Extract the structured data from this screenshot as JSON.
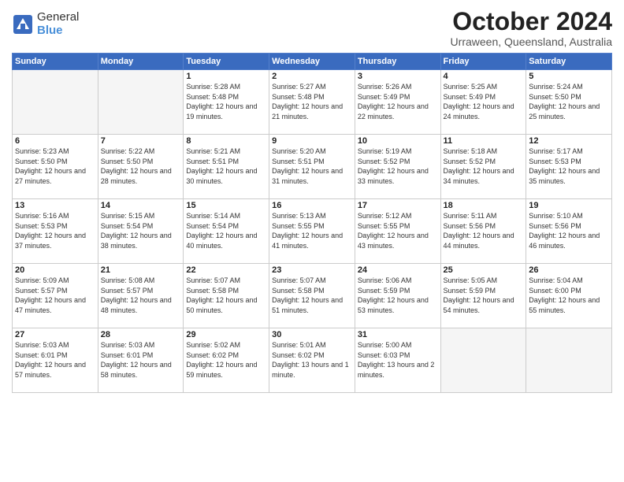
{
  "logo": {
    "general": "General",
    "blue": "Blue"
  },
  "header": {
    "month": "October 2024",
    "location": "Urraween, Queensland, Australia"
  },
  "weekdays": [
    "Sunday",
    "Monday",
    "Tuesday",
    "Wednesday",
    "Thursday",
    "Friday",
    "Saturday"
  ],
  "weeks": [
    [
      {
        "day": "",
        "empty": true
      },
      {
        "day": "",
        "empty": true
      },
      {
        "day": "1",
        "sunrise": "Sunrise: 5:28 AM",
        "sunset": "Sunset: 5:48 PM",
        "daylight": "Daylight: 12 hours and 19 minutes."
      },
      {
        "day": "2",
        "sunrise": "Sunrise: 5:27 AM",
        "sunset": "Sunset: 5:48 PM",
        "daylight": "Daylight: 12 hours and 21 minutes."
      },
      {
        "day": "3",
        "sunrise": "Sunrise: 5:26 AM",
        "sunset": "Sunset: 5:49 PM",
        "daylight": "Daylight: 12 hours and 22 minutes."
      },
      {
        "day": "4",
        "sunrise": "Sunrise: 5:25 AM",
        "sunset": "Sunset: 5:49 PM",
        "daylight": "Daylight: 12 hours and 24 minutes."
      },
      {
        "day": "5",
        "sunrise": "Sunrise: 5:24 AM",
        "sunset": "Sunset: 5:50 PM",
        "daylight": "Daylight: 12 hours and 25 minutes."
      }
    ],
    [
      {
        "day": "6",
        "sunrise": "Sunrise: 5:23 AM",
        "sunset": "Sunset: 5:50 PM",
        "daylight": "Daylight: 12 hours and 27 minutes."
      },
      {
        "day": "7",
        "sunrise": "Sunrise: 5:22 AM",
        "sunset": "Sunset: 5:50 PM",
        "daylight": "Daylight: 12 hours and 28 minutes."
      },
      {
        "day": "8",
        "sunrise": "Sunrise: 5:21 AM",
        "sunset": "Sunset: 5:51 PM",
        "daylight": "Daylight: 12 hours and 30 minutes."
      },
      {
        "day": "9",
        "sunrise": "Sunrise: 5:20 AM",
        "sunset": "Sunset: 5:51 PM",
        "daylight": "Daylight: 12 hours and 31 minutes."
      },
      {
        "day": "10",
        "sunrise": "Sunrise: 5:19 AM",
        "sunset": "Sunset: 5:52 PM",
        "daylight": "Daylight: 12 hours and 33 minutes."
      },
      {
        "day": "11",
        "sunrise": "Sunrise: 5:18 AM",
        "sunset": "Sunset: 5:52 PM",
        "daylight": "Daylight: 12 hours and 34 minutes."
      },
      {
        "day": "12",
        "sunrise": "Sunrise: 5:17 AM",
        "sunset": "Sunset: 5:53 PM",
        "daylight": "Daylight: 12 hours and 35 minutes."
      }
    ],
    [
      {
        "day": "13",
        "sunrise": "Sunrise: 5:16 AM",
        "sunset": "Sunset: 5:53 PM",
        "daylight": "Daylight: 12 hours and 37 minutes."
      },
      {
        "day": "14",
        "sunrise": "Sunrise: 5:15 AM",
        "sunset": "Sunset: 5:54 PM",
        "daylight": "Daylight: 12 hours and 38 minutes."
      },
      {
        "day": "15",
        "sunrise": "Sunrise: 5:14 AM",
        "sunset": "Sunset: 5:54 PM",
        "daylight": "Daylight: 12 hours and 40 minutes."
      },
      {
        "day": "16",
        "sunrise": "Sunrise: 5:13 AM",
        "sunset": "Sunset: 5:55 PM",
        "daylight": "Daylight: 12 hours and 41 minutes."
      },
      {
        "day": "17",
        "sunrise": "Sunrise: 5:12 AM",
        "sunset": "Sunset: 5:55 PM",
        "daylight": "Daylight: 12 hours and 43 minutes."
      },
      {
        "day": "18",
        "sunrise": "Sunrise: 5:11 AM",
        "sunset": "Sunset: 5:56 PM",
        "daylight": "Daylight: 12 hours and 44 minutes."
      },
      {
        "day": "19",
        "sunrise": "Sunrise: 5:10 AM",
        "sunset": "Sunset: 5:56 PM",
        "daylight": "Daylight: 12 hours and 46 minutes."
      }
    ],
    [
      {
        "day": "20",
        "sunrise": "Sunrise: 5:09 AM",
        "sunset": "Sunset: 5:57 PM",
        "daylight": "Daylight: 12 hours and 47 minutes."
      },
      {
        "day": "21",
        "sunrise": "Sunrise: 5:08 AM",
        "sunset": "Sunset: 5:57 PM",
        "daylight": "Daylight: 12 hours and 48 minutes."
      },
      {
        "day": "22",
        "sunrise": "Sunrise: 5:07 AM",
        "sunset": "Sunset: 5:58 PM",
        "daylight": "Daylight: 12 hours and 50 minutes."
      },
      {
        "day": "23",
        "sunrise": "Sunrise: 5:07 AM",
        "sunset": "Sunset: 5:58 PM",
        "daylight": "Daylight: 12 hours and 51 minutes."
      },
      {
        "day": "24",
        "sunrise": "Sunrise: 5:06 AM",
        "sunset": "Sunset: 5:59 PM",
        "daylight": "Daylight: 12 hours and 53 minutes."
      },
      {
        "day": "25",
        "sunrise": "Sunrise: 5:05 AM",
        "sunset": "Sunset: 5:59 PM",
        "daylight": "Daylight: 12 hours and 54 minutes."
      },
      {
        "day": "26",
        "sunrise": "Sunrise: 5:04 AM",
        "sunset": "Sunset: 6:00 PM",
        "daylight": "Daylight: 12 hours and 55 minutes."
      }
    ],
    [
      {
        "day": "27",
        "sunrise": "Sunrise: 5:03 AM",
        "sunset": "Sunset: 6:01 PM",
        "daylight": "Daylight: 12 hours and 57 minutes."
      },
      {
        "day": "28",
        "sunrise": "Sunrise: 5:03 AM",
        "sunset": "Sunset: 6:01 PM",
        "daylight": "Daylight: 12 hours and 58 minutes."
      },
      {
        "day": "29",
        "sunrise": "Sunrise: 5:02 AM",
        "sunset": "Sunset: 6:02 PM",
        "daylight": "Daylight: 12 hours and 59 minutes."
      },
      {
        "day": "30",
        "sunrise": "Sunrise: 5:01 AM",
        "sunset": "Sunset: 6:02 PM",
        "daylight": "Daylight: 13 hours and 1 minute."
      },
      {
        "day": "31",
        "sunrise": "Sunrise: 5:00 AM",
        "sunset": "Sunset: 6:03 PM",
        "daylight": "Daylight: 13 hours and 2 minutes."
      },
      {
        "day": "",
        "empty": true
      },
      {
        "day": "",
        "empty": true
      }
    ]
  ]
}
